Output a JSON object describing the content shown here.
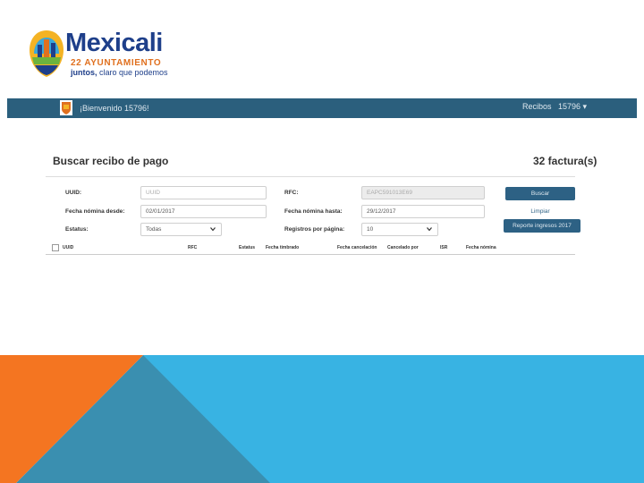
{
  "logo": {
    "title": "Mexicali",
    "subtitle": "22 AYUNTAMIENTO",
    "tagline_bold": "juntos,",
    "tagline_rest": " claro que podemos"
  },
  "topbar": {
    "welcome": "¡Bienvenido 15796!",
    "recibos": "Recibos",
    "user": "15796 ▾"
  },
  "panel": {
    "title": "Buscar recibo de pago",
    "count": "32 factura(s)"
  },
  "form": {
    "uuid_label": "UUID:",
    "uuid_placeholder": "UUID",
    "rfc_label": "RFC:",
    "rfc_value": "EAPC591013E69",
    "fecha_desde_label": "Fecha nómina desde:",
    "fecha_desde_value": "02/01/2017",
    "fecha_hasta_label": "Fecha nómina hasta:",
    "fecha_hasta_value": "29/12/2017",
    "estatus_label": "Estatus:",
    "estatus_value": "Todas",
    "registros_label": "Registros por página:",
    "registros_value": "10"
  },
  "buttons": {
    "buscar": "Buscar",
    "limpiar": "Limpiar",
    "reporte": "Reporte ingresos 2017"
  },
  "table": {
    "columns": [
      "UUID",
      "RFC",
      "Estatus",
      "Fecha timbrado",
      "Fecha cancelación",
      "Cancelado por",
      "ISR",
      "Fecha nómina"
    ]
  },
  "colors": {
    "topbar": "#2b5f7d",
    "button": "#2d6184",
    "orange": "#f47521",
    "teal": "#3a8fb0",
    "sky": "#38b3e3"
  }
}
